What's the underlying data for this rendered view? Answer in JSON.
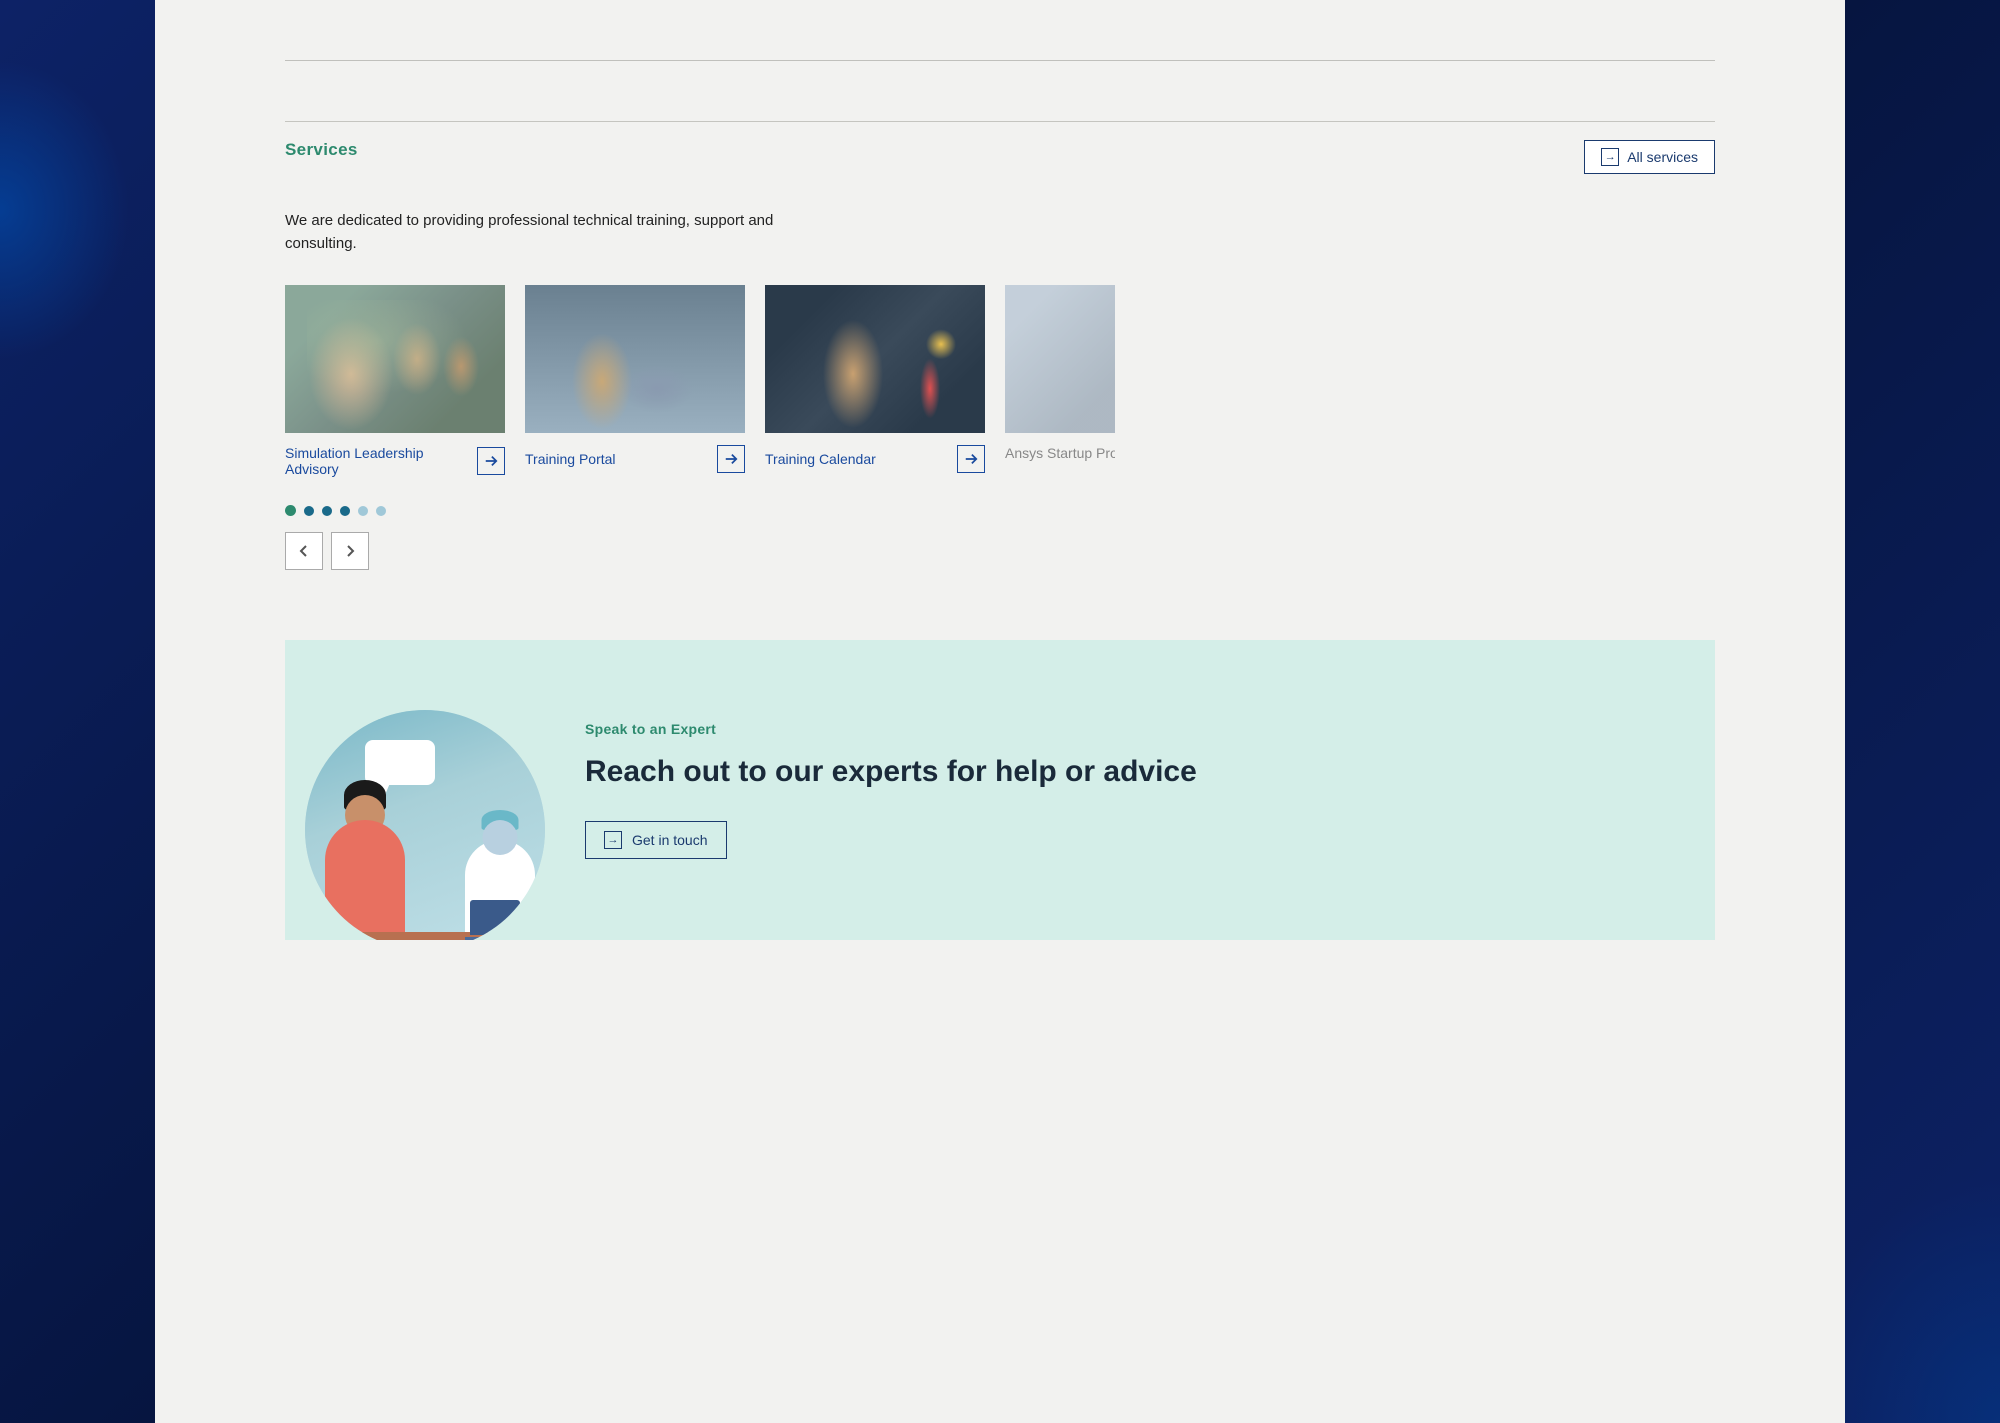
{
  "background": {
    "left_color": "#0a1f5c",
    "right_color": "#061540"
  },
  "services": {
    "label": "Services",
    "description": "We are dedicated to providing professional technical training, support and consulting.",
    "all_services_btn": "All services",
    "cards": [
      {
        "id": 1,
        "title": "Simulation Leadership Advisory",
        "img_type": "people"
      },
      {
        "id": 2,
        "title": "Training Portal",
        "img_type": "computer"
      },
      {
        "id": 3,
        "title": "Training Calendar",
        "img_type": "board"
      },
      {
        "id": 4,
        "title": "Ansys Startup Program",
        "img_type": "startup",
        "partial": true
      }
    ],
    "dots": [
      {
        "active": true
      },
      {
        "active": false
      },
      {
        "active": false
      },
      {
        "active": false
      },
      {
        "active": false
      },
      {
        "active": false
      }
    ]
  },
  "expert": {
    "label": "Speak to an Expert",
    "title": "Reach out to our experts for help or advice",
    "cta_btn": "Get in touch"
  }
}
